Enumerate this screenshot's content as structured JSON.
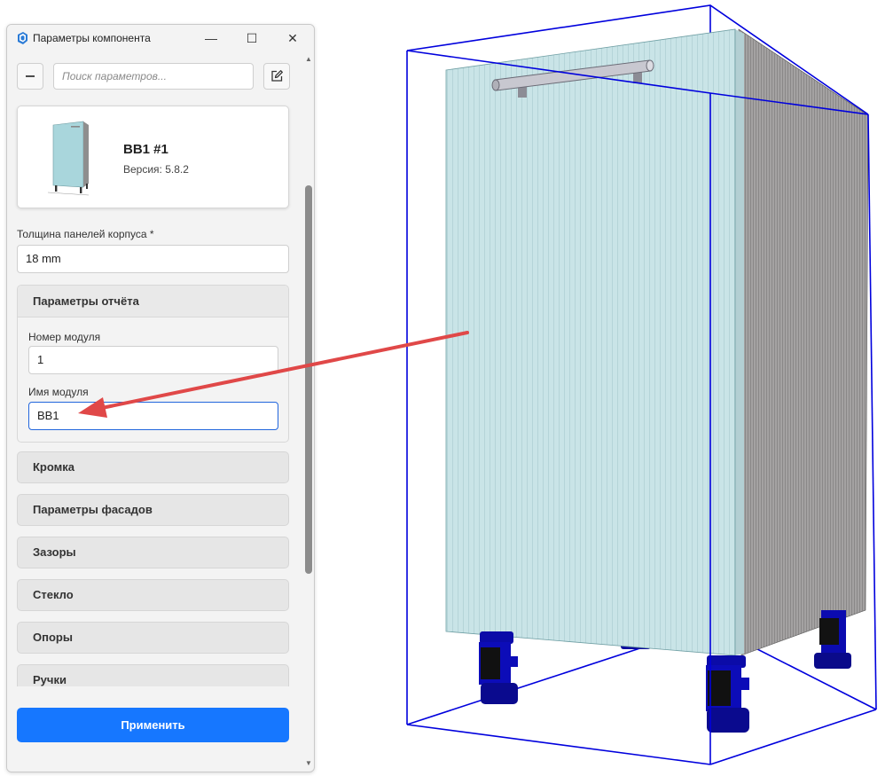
{
  "window": {
    "title": "Параметры компонента",
    "controls": {
      "minimize": "—",
      "maximize": "☐",
      "close": "✕"
    }
  },
  "toolbar": {
    "collapse_icon": "minus-icon",
    "search_placeholder": "Поиск параметров...",
    "edit_icon": "edit-icon"
  },
  "component": {
    "name": "BB1 #1",
    "version": "Версия: 5.8.2"
  },
  "fields": {
    "panel_thickness_label": "Толщина панелей корпуса *",
    "panel_thickness_value": "18 mm"
  },
  "report_group": {
    "title": "Параметры отчёта",
    "module_number_label": "Номер модуля",
    "module_number_value": "1",
    "module_name_label": "Имя модуля",
    "module_name_value": "BB1"
  },
  "sections": [
    "Кромка",
    "Параметры фасадов",
    "Зазоры",
    "Стекло",
    "Опоры",
    "Ручки"
  ],
  "apply_label": "Применить",
  "colors": {
    "accent": "#1677ff",
    "focus_border": "#2266dd",
    "annotation_arrow": "#e04848",
    "bounding_box": "#0000dd",
    "door_panel": "#c8e3e6",
    "side_panel": "#9a9898"
  }
}
